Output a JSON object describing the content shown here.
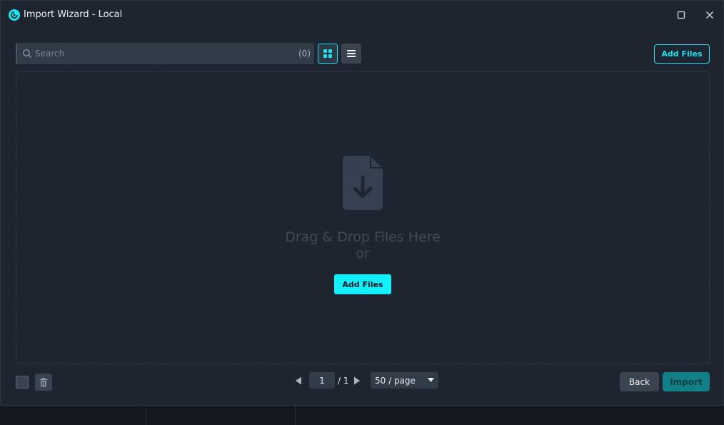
{
  "window": {
    "title": "Import Wizard - Local"
  },
  "toolbar": {
    "search_placeholder": "Search",
    "search_count": "(0)",
    "add_files_label": "Add Files"
  },
  "dropzone": {
    "line1": "Drag & Drop Files Here",
    "line2": "or",
    "add_files_label": "Add Files"
  },
  "pagination": {
    "current_page": "1",
    "total_pages": "/ 1",
    "page_size": "50 / page"
  },
  "actions": {
    "back_label": "Back",
    "import_label": "Import"
  },
  "colors": {
    "accent": "#12f0ff",
    "background": "#1e2530",
    "import_disabled": "#127f86"
  },
  "icons": {
    "app": "app-logo-icon",
    "maximize": "maximize-icon",
    "close": "close-icon",
    "search": "search-icon",
    "grid_view": "grid-view-icon",
    "list_view": "list-view-icon",
    "file_import": "file-download-icon",
    "delete": "trash-icon",
    "prev": "chevron-left-icon",
    "next": "chevron-right-icon",
    "dropdown": "caret-down-icon"
  }
}
